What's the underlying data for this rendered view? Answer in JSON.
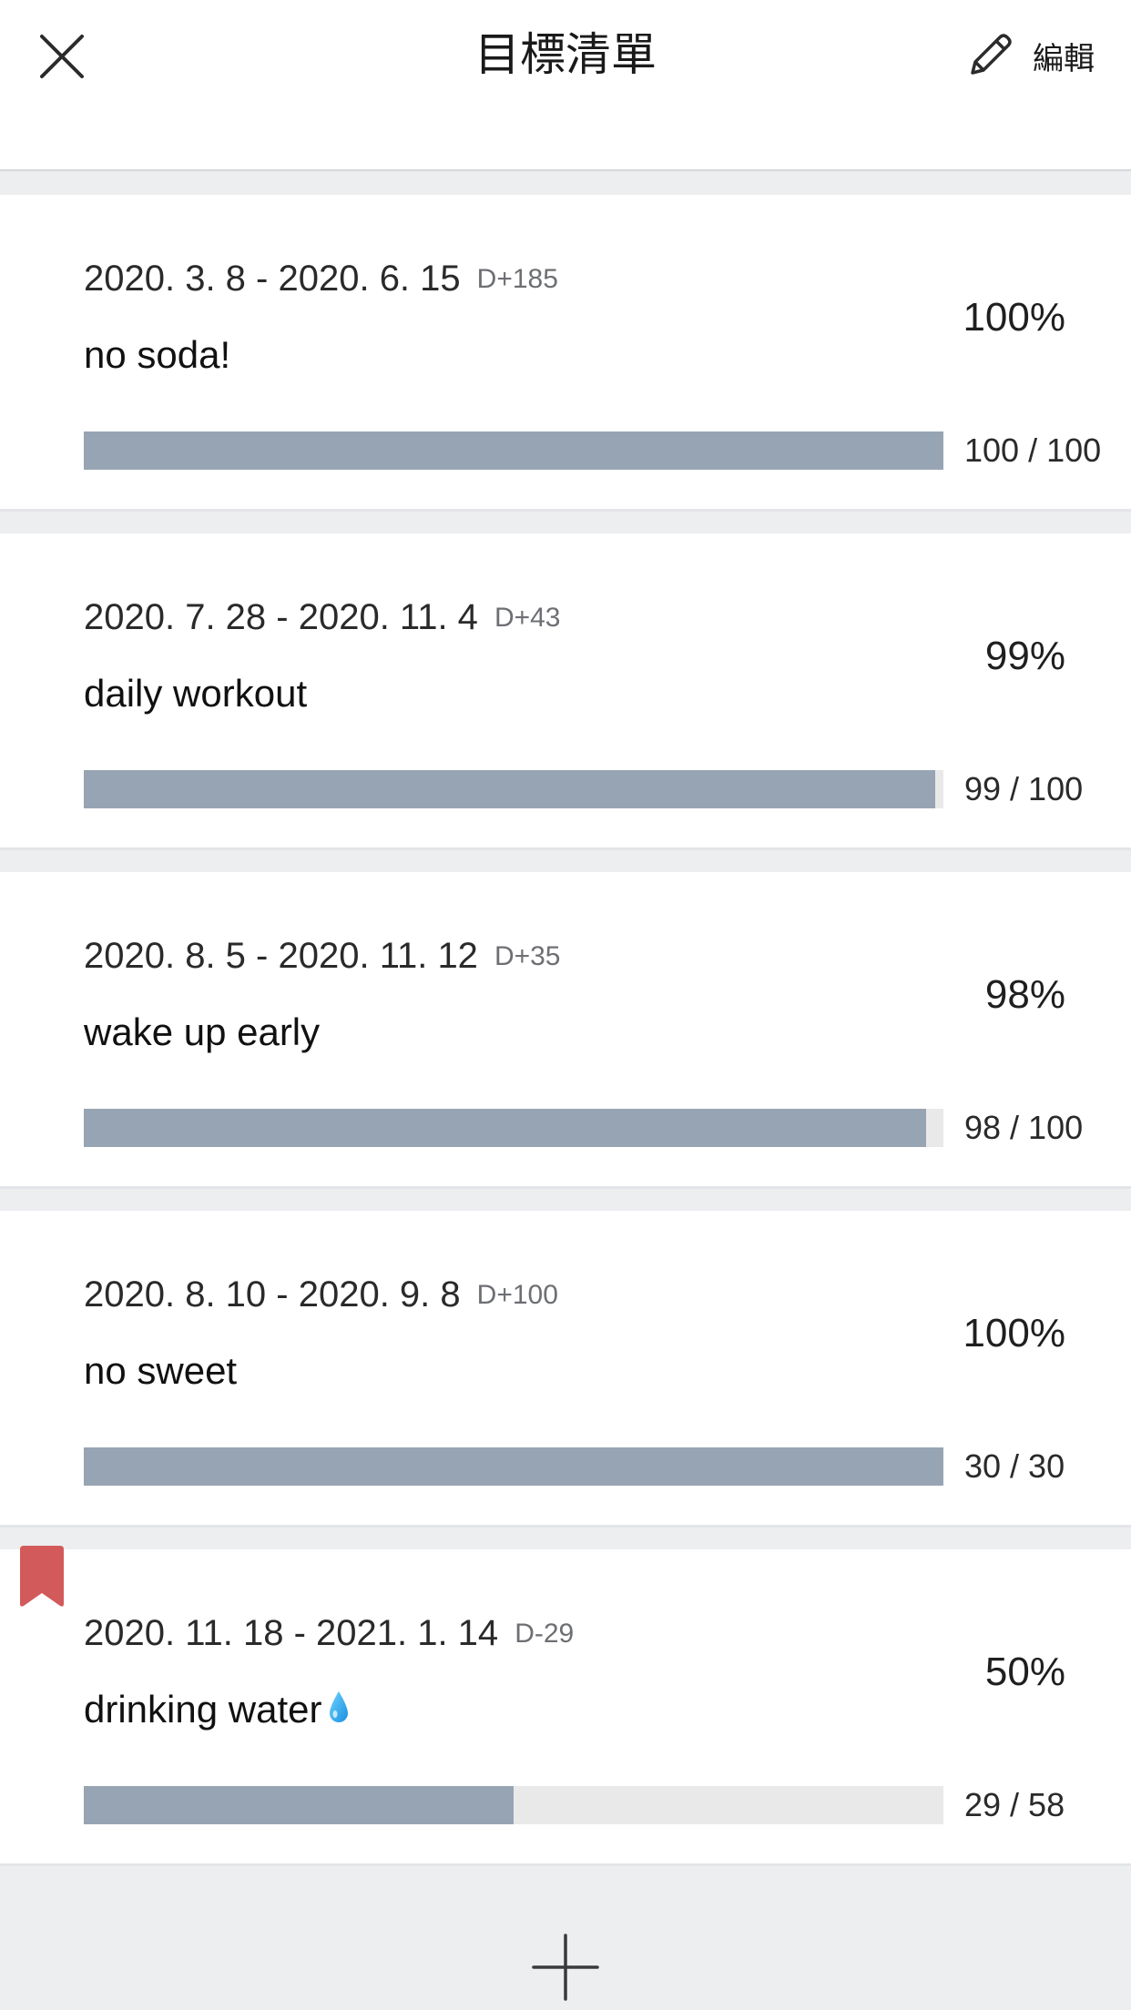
{
  "header": {
    "title": "目標清單",
    "edit_label": "編輯",
    "close_icon": "close-icon",
    "edit_icon": "pencil-icon"
  },
  "colors": {
    "progress_fill": "#97a4b3",
    "progress_track": "#e9e9ea",
    "bookmark": "#d35a5a",
    "page_background": "#edeef0"
  },
  "goals": [
    {
      "dates": "2020. 3. 8 - 2020. 6. 15",
      "dday": "D+185",
      "title": "no soda!",
      "percent": "100%",
      "count": "100 / 100",
      "progress": 1.0,
      "bookmarked": false
    },
    {
      "dates": "2020. 7. 28 - 2020. 11. 4",
      "dday": "D+43",
      "title": "daily workout",
      "percent": "99%",
      "count": "99 / 100",
      "progress": 0.99,
      "bookmarked": false
    },
    {
      "dates": "2020. 8. 5 - 2020. 11. 12",
      "dday": "D+35",
      "title": "wake up early",
      "percent": "98%",
      "count": "98 / 100",
      "progress": 0.98,
      "bookmarked": false
    },
    {
      "dates": "2020. 8. 10 - 2020. 9. 8",
      "dday": "D+100",
      "title": "no sweet",
      "percent": "100%",
      "count": "30 / 30",
      "progress": 1.0,
      "bookmarked": false
    },
    {
      "dates": "2020. 11. 18 - 2021. 1. 14",
      "dday": "D-29",
      "title": "drinking water",
      "title_icon": "water-drop-icon",
      "percent": "50%",
      "count": "29 / 58",
      "progress": 0.5,
      "bookmarked": true
    }
  ],
  "footer": {
    "add_icon": "plus-icon"
  }
}
